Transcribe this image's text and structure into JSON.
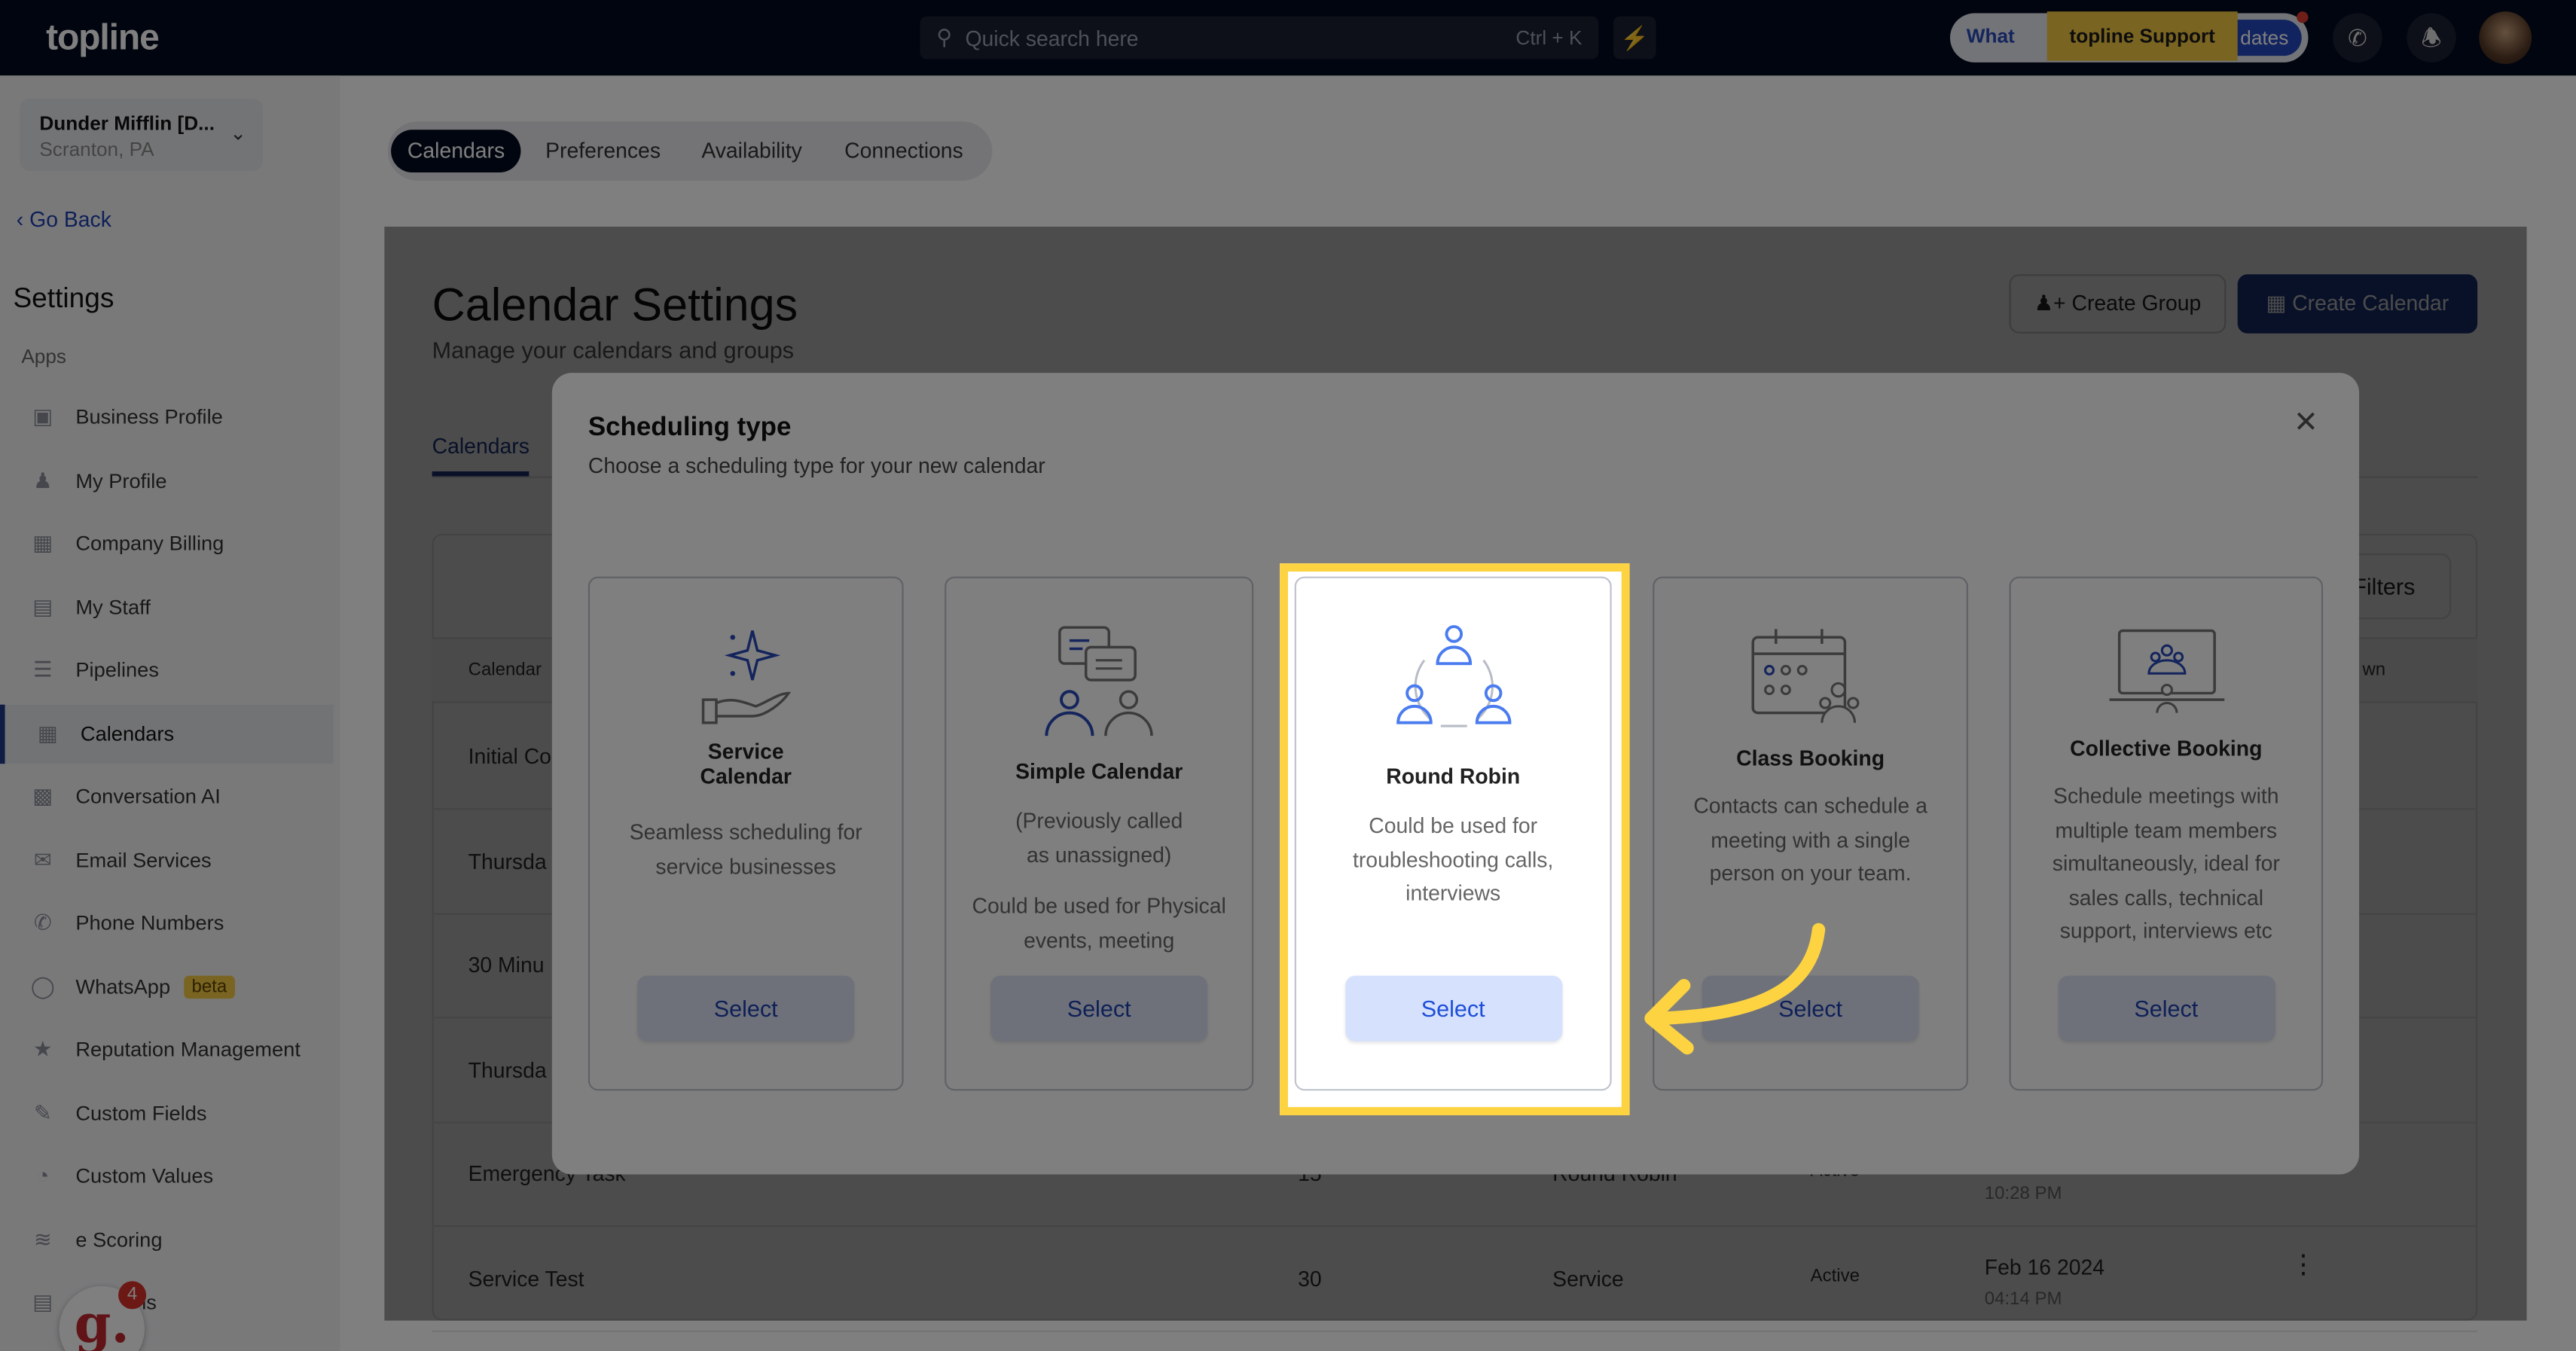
{
  "topbar": {
    "logo": "topline",
    "search_placeholder": "Quick search here",
    "search_shortcut": "Ctrl + K",
    "whats_new": "What",
    "updates": "dates",
    "support": "topline Support"
  },
  "account": {
    "name": "Dunder Mifflin [D...",
    "location": "Scranton, PA"
  },
  "sidebar": {
    "go_back": "Go Back",
    "heading": "Settings",
    "section": "Apps",
    "items": [
      {
        "label": "Business Profile",
        "icon": "briefcase-icon"
      },
      {
        "label": "My Profile",
        "icon": "person-icon"
      },
      {
        "label": "Company Billing",
        "icon": "grid-icon"
      },
      {
        "label": "My Staff",
        "icon": "staff-icon"
      },
      {
        "label": "Pipelines",
        "icon": "filter-icon"
      },
      {
        "label": "Calendars",
        "icon": "calendar-icon",
        "active": true
      },
      {
        "label": "Conversation AI",
        "icon": "chat-icon"
      },
      {
        "label": "Email Services",
        "icon": "mail-icon"
      },
      {
        "label": "Phone Numbers",
        "icon": "phone-icon"
      },
      {
        "label": "WhatsApp",
        "icon": "whatsapp-icon",
        "badge": "beta"
      },
      {
        "label": "Reputation Management",
        "icon": "star-icon"
      },
      {
        "label": "Custom Fields",
        "icon": "edit-icon"
      },
      {
        "label": "Custom Values",
        "icon": "pie-icon"
      },
      {
        "label": "e Scoring",
        "icon": "chart-icon"
      },
      {
        "label": "Domains",
        "icon": "domain-icon"
      }
    ],
    "widget_count": "4",
    "widget_letter": "g."
  },
  "tabs": [
    "Calendars",
    "Preferences",
    "Availability",
    "Connections"
  ],
  "content": {
    "title": "Calendar Settings",
    "subtitle": "Manage your calendars and groups",
    "create_group": "Create Group",
    "create_calendar": "Create Calendar",
    "subtab": "Calendars",
    "filters": "Filters",
    "table": {
      "headers": [
        "Calendar",
        "wn"
      ],
      "rows": [
        {
          "name": "Initial Co"
        },
        {
          "name": "Thursda"
        },
        {
          "name": "30 Minu"
        },
        {
          "name": "Thursda"
        },
        {
          "name": "Emergency Task",
          "duration": "15",
          "type": "Round Robin",
          "status": "Active",
          "time": "10:28 PM"
        },
        {
          "name": "Service Test",
          "duration": "30",
          "type": "Service",
          "status": "Active",
          "date": "Feb 16 2024",
          "time": "04:14 PM"
        }
      ]
    }
  },
  "modal": {
    "title": "Scheduling type",
    "subtitle": "Choose a scheduling type for your new calendar",
    "cards": [
      {
        "title": "Service Calendar",
        "desc": "Seamless scheduling for service businesses",
        "button": "Select"
      },
      {
        "title": "Simple Calendar",
        "desc": "(Previously called as unassigned)",
        "desc2": "Could be used for Physical events, meeting",
        "button": "Select"
      },
      {
        "title": "Round Robin",
        "desc": "Could be used for troubleshooting calls, interviews",
        "button": "Select",
        "highlighted": true
      },
      {
        "title": "Class Booking",
        "desc": "Contacts can schedule a meeting with a single person on your team.",
        "button": "Select"
      },
      {
        "title": "Collective Booking",
        "desc": "Schedule meetings with multiple team members simultaneously, ideal for sales calls, technical support, interviews etc",
        "button": "Select"
      }
    ]
  },
  "colors": {
    "topbar": "#020a1f",
    "primary": "#1e3a8a",
    "highlight": "#fdd342",
    "select_bg": "#dce3f5"
  }
}
